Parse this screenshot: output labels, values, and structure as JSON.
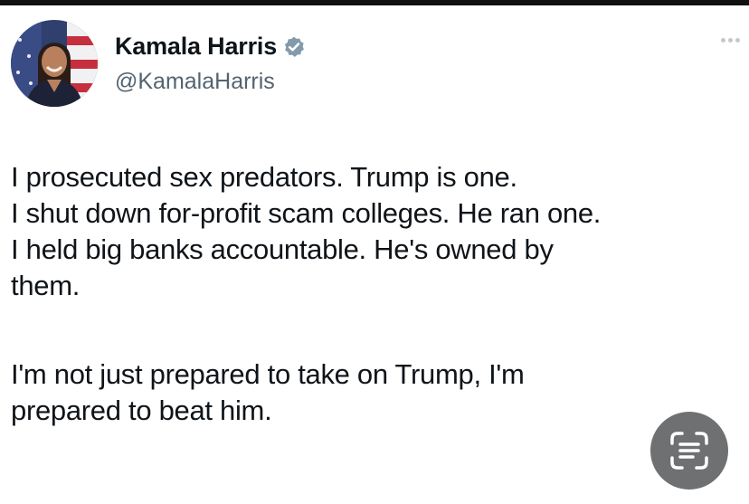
{
  "author": {
    "display_name": "Kamala Harris",
    "handle": "@KamalaHarris",
    "verified": true,
    "avatar_icon": "profile-photo",
    "verified_icon": "verified-badge-icon"
  },
  "tweet": {
    "lines": [
      "I prosecuted sex predators. Trump is one.",
      "I shut down for-profit scam colleges. He ran one.",
      "I held big banks accountable. He's owned by",
      "them.",
      "I'm not just prepared to take on Trump, I'm",
      "prepared to beat him."
    ]
  },
  "icons": {
    "more": "more-options-icon",
    "scan": "text-scan-icon"
  },
  "colors": {
    "name": "#0f1419",
    "handle": "#536471",
    "verified": "#829aab",
    "scan_button": "#6e7072"
  }
}
